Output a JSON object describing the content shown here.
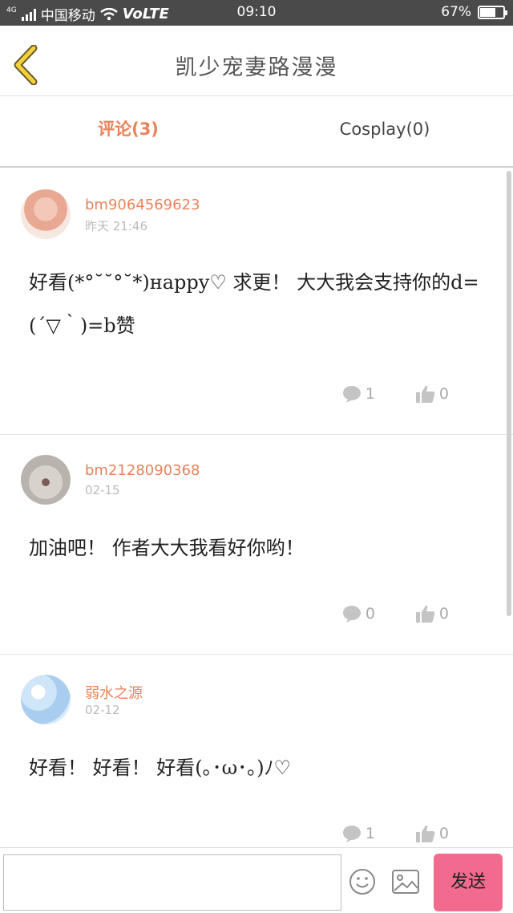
{
  "status_bar": {
    "network": "4G",
    "carrier": "中国移动",
    "volte": "VoLTE",
    "time": "09:10",
    "battery_text": "67%",
    "battery_level": 0.67
  },
  "header": {
    "back_icon": "chevron-left-icon",
    "title": "凯少宠妻路漫漫"
  },
  "tabs": [
    {
      "label": "评论(3)",
      "active": true
    },
    {
      "label": "Cosplay(0)",
      "active": false
    }
  ],
  "comments": [
    {
      "username": "bm9064569623",
      "time": "昨天 21:46",
      "text": "好看(*°˘˘°˘*)ʜappy♡ 求更！ 大大我会支持你的d=(´▽｀)=b赞",
      "replies": "1",
      "likes": "0"
    },
    {
      "username": "bm2128090368",
      "time": "02-15",
      "text": "加油吧！ 作者大大我看好你哟！",
      "replies": "0",
      "likes": "0"
    },
    {
      "username": "弱水之源",
      "time": "02-12",
      "text": "好看！ 好看！ 好看(｡･ω･｡)ﾉ♡",
      "replies": "1",
      "likes": "0"
    }
  ],
  "input_bar": {
    "placeholder": "",
    "emoji_icon": "emoji-icon",
    "image_icon": "image-icon",
    "send_label": "发送"
  },
  "colors": {
    "accent": "#e8835a",
    "send_button": "#f26b8f",
    "status_bar": "#4a4a4a"
  }
}
